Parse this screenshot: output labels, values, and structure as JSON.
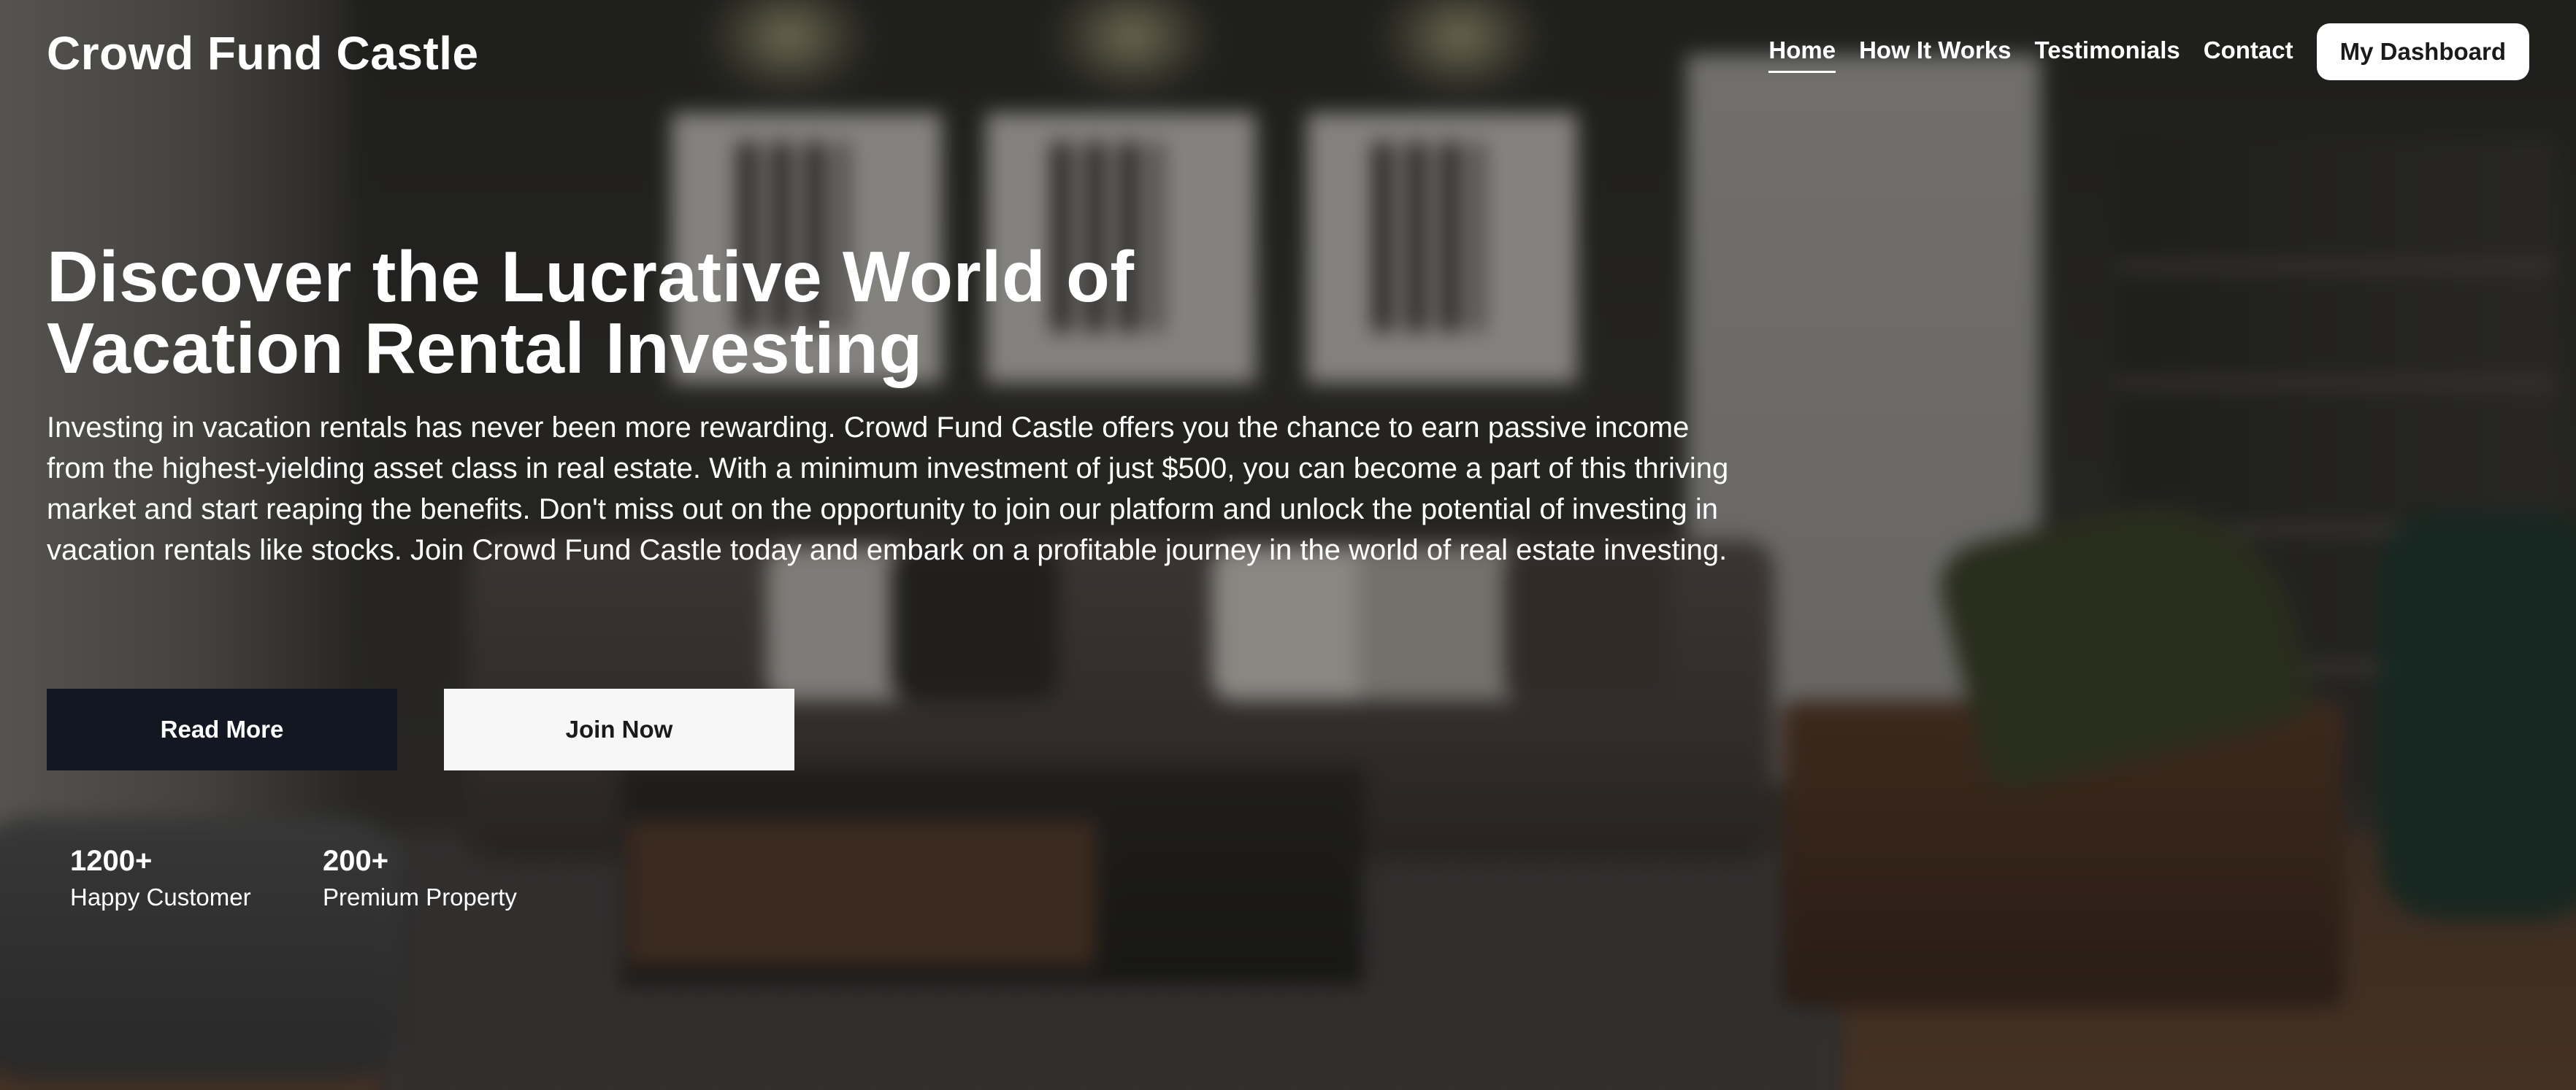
{
  "header": {
    "brand": "Crowd Fund Castle",
    "nav": [
      {
        "label": "Home",
        "active": true
      },
      {
        "label": "How It Works",
        "active": false
      },
      {
        "label": "Testimonials",
        "active": false
      },
      {
        "label": "Contact",
        "active": false
      }
    ],
    "dashboard_label": "My Dashboard"
  },
  "hero": {
    "title_line1": "Discover the Lucrative World of",
    "title_line2": "Vacation Rental Investing",
    "description": "Investing in vacation rentals has never been more rewarding. Crowd Fund Castle offers you the chance to earn passive income from the highest-yielding asset class in real estate. With a minimum investment of just $500, you can become a part of this thriving market and start reaping the benefits. Don't miss out on the opportunity to join our platform and unlock the potential of investing in vacation rentals like stocks. Join Crowd Fund Castle today and embark on a profitable journey in the world of real estate investing.",
    "read_more_label": "Read More",
    "join_now_label": "Join Now"
  },
  "stats": [
    {
      "value": "1200+",
      "label": "Happy Customer"
    },
    {
      "value": "200+",
      "label": "Premium Property"
    }
  ],
  "colors": {
    "dark_button": "#121722",
    "light_button": "#f7f7f7",
    "text": "#ffffff"
  }
}
